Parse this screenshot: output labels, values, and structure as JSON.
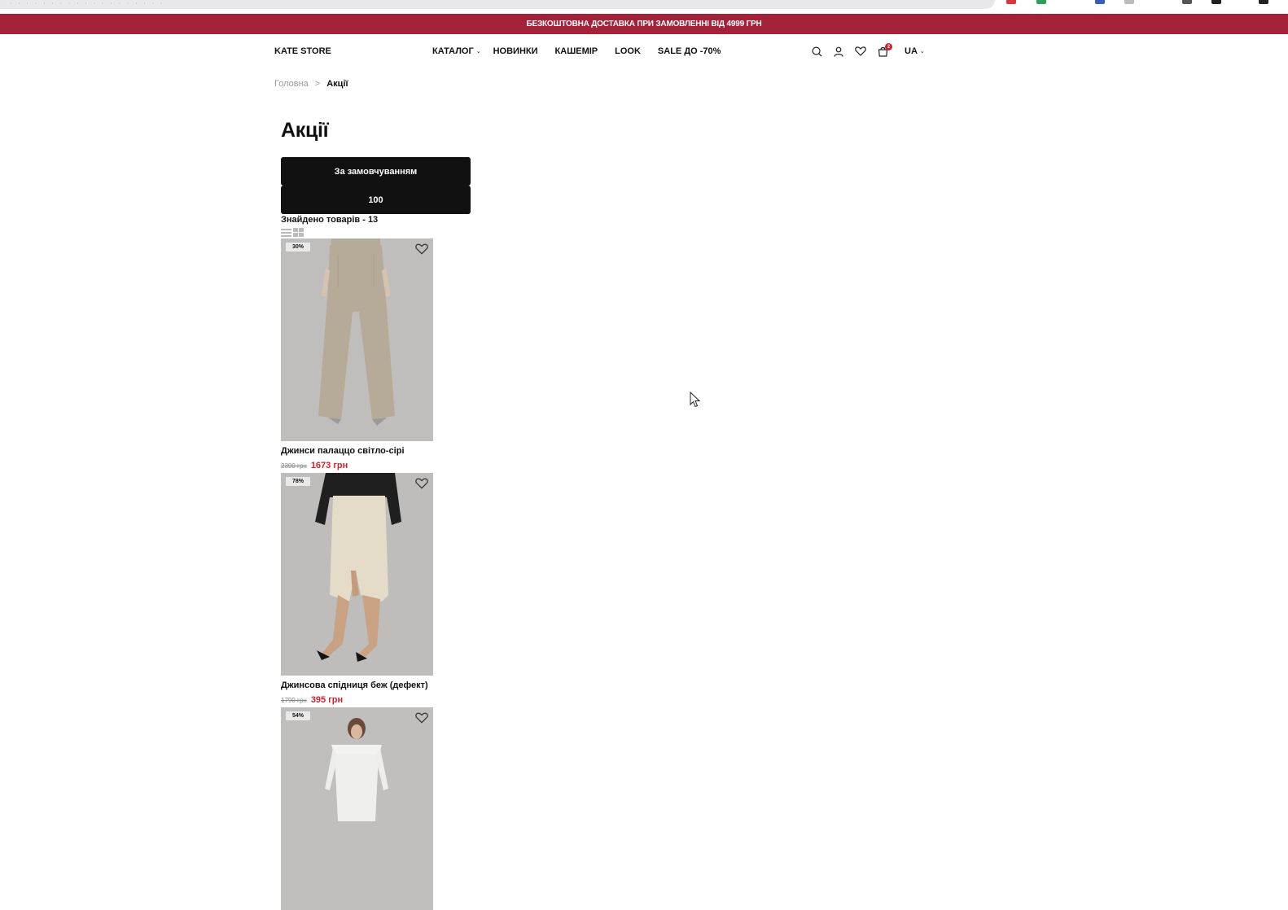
{
  "promo": {
    "text": "БЕЗКОШТОВНА ДОСТАВКА ПРИ ЗАМОВЛЕННІ ВІД 4999 ГРН"
  },
  "header": {
    "logo": "KATE STORE",
    "nav": [
      {
        "label": "КАТАЛОГ",
        "has_dropdown": true
      },
      {
        "label": "НОВИНКИ"
      },
      {
        "label": "КАШЕМІР"
      },
      {
        "label": "LOOK"
      },
      {
        "label": "SALE ДО -70%"
      }
    ],
    "cart_count": "2",
    "language": "UA",
    "icons": [
      "search-icon",
      "user-icon",
      "heart-icon",
      "cart-icon"
    ]
  },
  "breadcrumb": {
    "home": "Головна",
    "separator": ">",
    "current": "Акції"
  },
  "page": {
    "title": "Акції",
    "sort_select": "За замовчуванням",
    "count_select": "100",
    "found_text": "Знайдено товарів - 13"
  },
  "products": [
    {
      "badge": "30%",
      "name": "Джинси палаццо світло-сірі",
      "old_price": "2390 грн",
      "new_price": "1673 грн"
    },
    {
      "badge": "78%",
      "name": "Джинсова спідниця беж (дефект)",
      "old_price": "1790 грн",
      "new_price": "395 грн"
    },
    {
      "badge": "54%",
      "name": "",
      "old_price": "",
      "new_price": ""
    }
  ],
  "colors": {
    "promo_bg": "#a3223a",
    "sale_price": "#d4202e",
    "select_bg": "#111111"
  }
}
